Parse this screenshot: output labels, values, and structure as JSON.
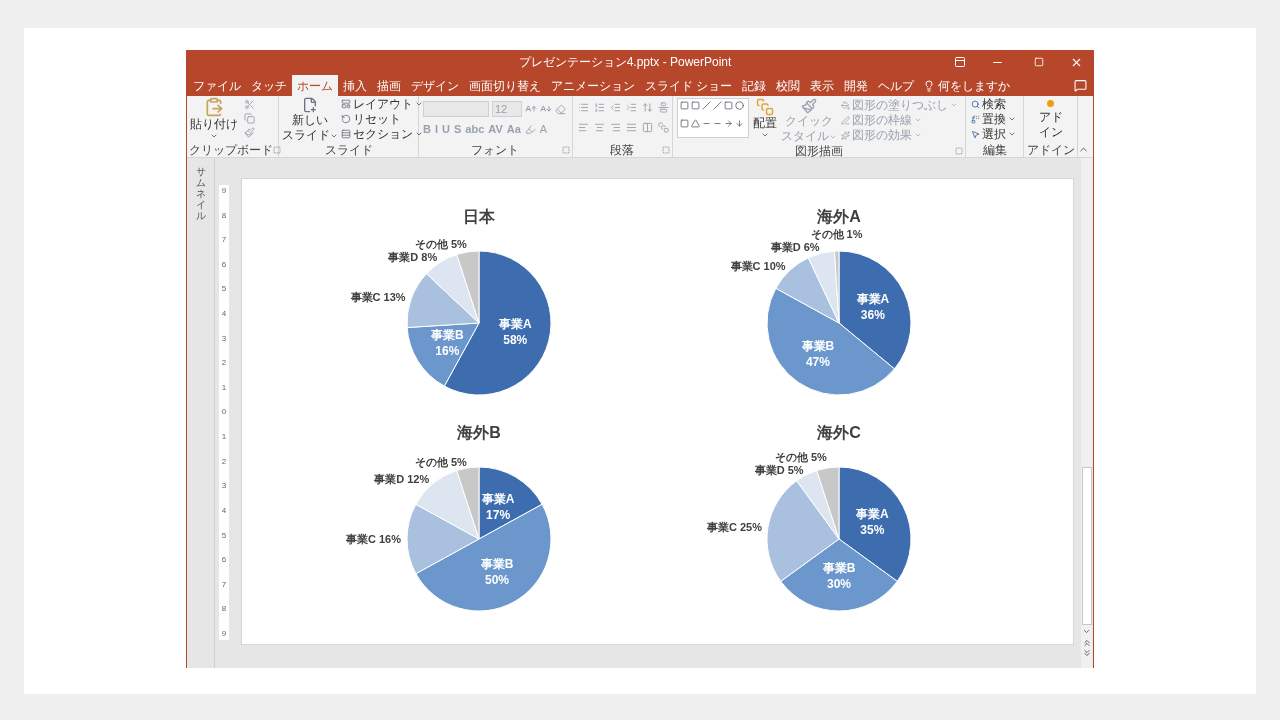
{
  "window": {
    "title": "プレゼンテーション4.pptx  -  PowerPoint"
  },
  "tabs": [
    {
      "label": "ファイル",
      "selected": false
    },
    {
      "label": "タッチ",
      "selected": false
    },
    {
      "label": "ホーム",
      "selected": true
    },
    {
      "label": "挿入",
      "selected": false
    },
    {
      "label": "描画",
      "selected": false
    },
    {
      "label": "デザイン",
      "selected": false
    },
    {
      "label": "画面切り替え",
      "selected": false
    },
    {
      "label": "アニメーション",
      "selected": false
    },
    {
      "label": "スライド ショー",
      "selected": false
    },
    {
      "label": "記録",
      "selected": false
    },
    {
      "label": "校閲",
      "selected": false
    },
    {
      "label": "表示",
      "selected": false
    },
    {
      "label": "開発",
      "selected": false
    },
    {
      "label": "ヘルプ",
      "selected": false
    }
  ],
  "tell_me": "何をしますか",
  "ribbon": {
    "clipboard": {
      "label": "クリップボード",
      "paste": "貼り付け"
    },
    "slides": {
      "label": "スライド",
      "new_slide": [
        "新しい",
        "スライド"
      ],
      "items": [
        "レイアウト",
        "リセット",
        "セクション"
      ]
    },
    "font": {
      "label": "フォント",
      "size": "12",
      "disabled": true,
      "format_buttons": [
        "B",
        "I",
        "U",
        "S",
        "abc",
        "AV",
        "Aa"
      ],
      "font_color": "A"
    },
    "paragraph": {
      "label": "段落"
    },
    "drawing": {
      "label": "図形描画",
      "arrange": "配置",
      "quick_style": {
        "label": [
          "クイック",
          "スタイル"
        ],
        "disabled": true
      },
      "items": [
        {
          "label": "図形の塗りつぶし",
          "disabled": true
        },
        {
          "label": "図形の枠線",
          "disabled": true
        },
        {
          "label": "図形の効果",
          "disabled": true
        }
      ]
    },
    "editing": {
      "label": "編集",
      "items": [
        "検索",
        "置換",
        "選択"
      ]
    },
    "addins": {
      "label": "アドイン",
      "button": [
        "アド",
        "イン"
      ]
    }
  },
  "thumbnail_pane": {
    "label": "サムネイル"
  },
  "ruler": [
    "9",
    "8",
    "7",
    "6",
    "5",
    "4",
    "3",
    "2",
    "1",
    "0",
    "1",
    "2",
    "3",
    "4",
    "5",
    "6",
    "7",
    "8",
    "9"
  ],
  "charts": [
    {
      "chart_data": {
        "type": "pie",
        "title": "日本",
        "categories": [
          "事業A",
          "事業B",
          "事業C",
          "事業D",
          "その他"
        ],
        "values": [
          58,
          16,
          13,
          8,
          5
        ],
        "value_labels": [
          "58%",
          "16%",
          "13%",
          "8%",
          "5%"
        ],
        "colors": [
          "#3e6daf",
          "#6b97cc",
          "#a9c0df",
          "#dde5f1",
          "#c8c8c8"
        ]
      }
    },
    {
      "chart_data": {
        "type": "pie",
        "title": "海外A",
        "categories": [
          "事業A",
          "事業B",
          "事業C",
          "事業D",
          "その他"
        ],
        "values": [
          36,
          47,
          10,
          6,
          1
        ],
        "value_labels": [
          "36%",
          "47%",
          "10%",
          "6%",
          "1%"
        ],
        "colors": [
          "#3e6daf",
          "#6b97cc",
          "#a9c0df",
          "#dde5f1",
          "#c8c8c8"
        ]
      }
    },
    {
      "chart_data": {
        "type": "pie",
        "title": "海外B",
        "categories": [
          "事業A",
          "事業B",
          "事業C",
          "事業D",
          "その他"
        ],
        "values": [
          17,
          50,
          16,
          12,
          5
        ],
        "value_labels": [
          "17%",
          "50%",
          "16%",
          "12%",
          "5%"
        ],
        "colors": [
          "#3e6daf",
          "#6b97cc",
          "#a9c0df",
          "#dde5f1",
          "#c8c8c8"
        ]
      }
    },
    {
      "chart_data": {
        "type": "pie",
        "title": "海外C",
        "categories": [
          "事業A",
          "事業B",
          "事業C",
          "事業D",
          "その他"
        ],
        "values": [
          35,
          30,
          25,
          5,
          5
        ],
        "value_labels": [
          "35%",
          "30%",
          "25%",
          "5%",
          "5%"
        ],
        "colors": [
          "#3e6daf",
          "#6b97cc",
          "#a9c0df",
          "#dde5f1",
          "#c8c8c8"
        ]
      }
    }
  ]
}
